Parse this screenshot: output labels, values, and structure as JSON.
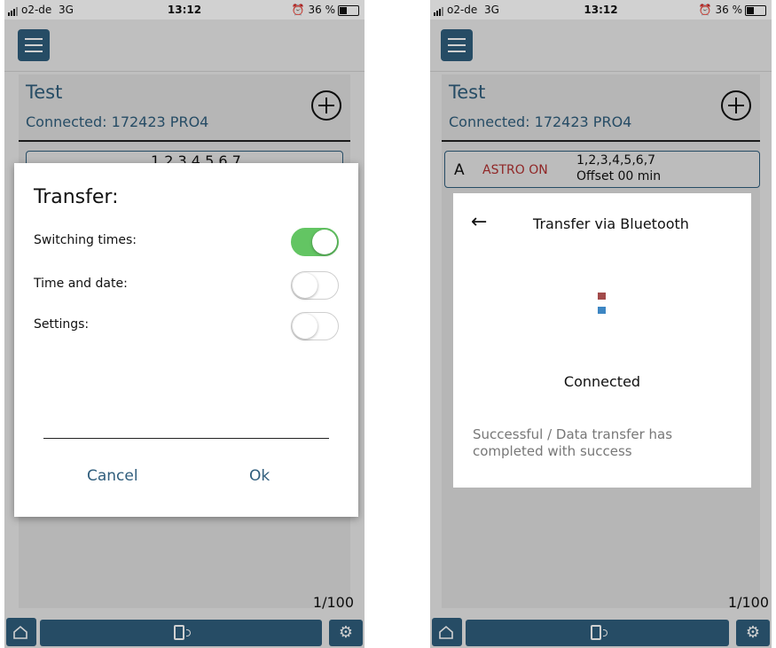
{
  "statusbar": {
    "carrier": "o2-de",
    "network": "3G",
    "time": "13:12",
    "alarm": "⏰",
    "battery": "36 %"
  },
  "app": {
    "title": "Test",
    "connected": "Connected: 172423 PRO4",
    "counter": "1/100"
  },
  "left": {
    "entry_days": "1,2,3,4,5,6,7",
    "dialog": {
      "title": "Transfer:",
      "options": [
        {
          "label": "Switching times:",
          "on": true
        },
        {
          "label": "Time and date:",
          "on": false
        },
        {
          "label": "Settings:",
          "on": false
        }
      ],
      "cancel": "Cancel",
      "ok": "Ok"
    }
  },
  "right": {
    "entry": {
      "letter": "A",
      "astro": "ASTRO ON",
      "days": "1,2,3,4,5,6,7",
      "offset": "Offset 00 min"
    },
    "dialog": {
      "back_icon": "arrow-left-icon",
      "title": "Transfer via Bluetooth",
      "status": "Connected",
      "message": "Successful / Data transfer has completed with success"
    }
  },
  "colors": {
    "accent": "#2f5d7c",
    "toggle_on": "#63c563",
    "astro": "#b03030"
  },
  "icons": {
    "menu": "hamburger-icon",
    "add": "plus-circle-icon",
    "home": "home-icon",
    "transfer": "phone-transfer-icon",
    "settings": "gear-icon"
  }
}
